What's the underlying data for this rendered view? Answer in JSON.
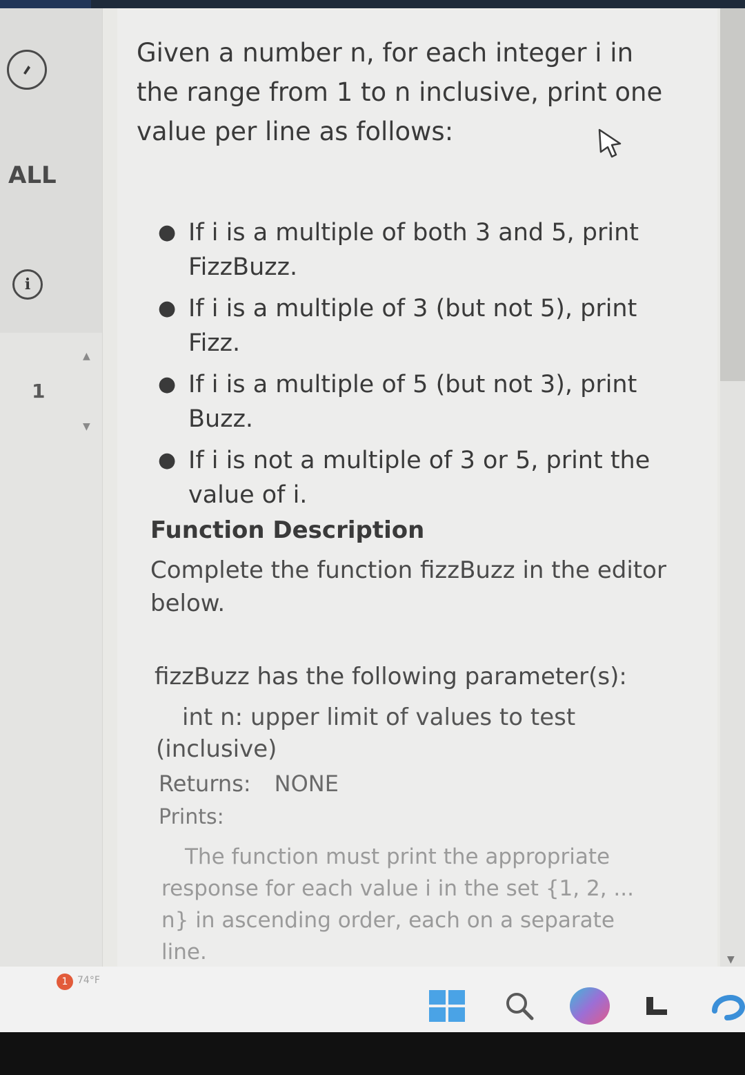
{
  "sidebar": {
    "all_label": "ALL",
    "line_number": "1"
  },
  "intro": "Given a number n, for each integer i in the range from 1 to n inclusive, print one value per line as follows:",
  "bullets": [
    "If i is a multiple of both 3 and 5, print FizzBuzz.",
    "If i is a multiple of 3 (but not 5), print Fizz.",
    "If i is a multiple of 5 (but not 3), print Buzz.",
    "If i is not a multiple of 3 or 5, print the value of i."
  ],
  "function_section": {
    "title": "Function Description",
    "description": "Complete the function fizzBuzz in the editor below.",
    "params_heading": "fizzBuzz has the following parameter(s):",
    "param_1": "int n: upper limit of values to test (inclusive)",
    "returns_label": "Returns:",
    "returns_value": "NONE",
    "prints_label": "Prints:",
    "prints_description": "The function must print the appropriate response for each value i in the set {1, 2, ... n} in ascending order, each on a separate line."
  },
  "taskbar": {
    "notification_count": "1",
    "weather": "74°F"
  },
  "colors": {
    "background": "#ededec",
    "sidebar": "#e4e4e2",
    "text": "#3a3a3a",
    "taskbar_accent": "#4aa3e6"
  },
  "icons": [
    "compass-icon",
    "info-icon",
    "cursor-icon",
    "windows-start-icon",
    "search-icon",
    "copilot-icon",
    "taskview-icon",
    "edge-icon"
  ]
}
